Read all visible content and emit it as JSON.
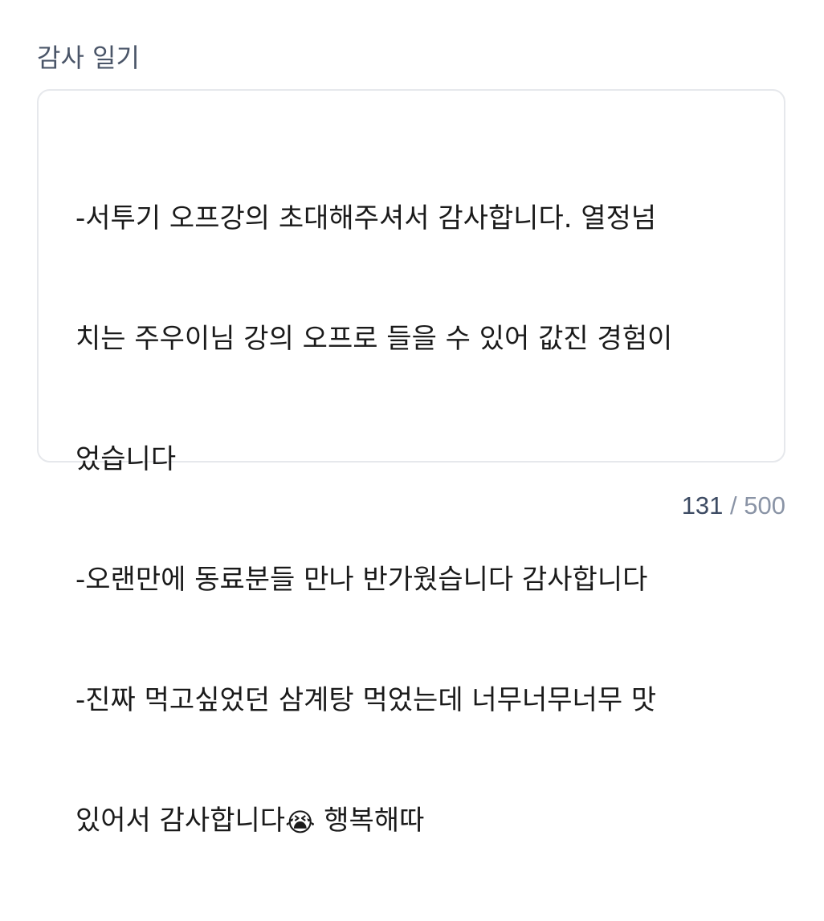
{
  "field": {
    "label": "감사 일기",
    "lines": [
      "-서투기 오프강의 초대해주셔서 감사합니다. 열정넘",
      "치는 주우이님 강의 오프로 들을 수 있어 값진 경험이",
      "었습니다",
      "-오랜만에 동료분들 만나 반가웠습니다 감사합니다",
      "-진짜 먹고싶었던 삼계탕 먹었는데 너무너무너무 맛",
      "있어서 감사합니다"
    ],
    "emoji": "😭",
    "emoji_name": "loudly-crying-face-icon",
    "last_line_tail": " 행복해따"
  },
  "counter": {
    "current": "131",
    "separator": " / ",
    "max": "500"
  },
  "colors": {
    "label": "#4a5568",
    "text": "#1a1a1a",
    "border": "#e6e8ec",
    "counter_current": "#3d4b63",
    "counter_max": "#8a94a6"
  }
}
